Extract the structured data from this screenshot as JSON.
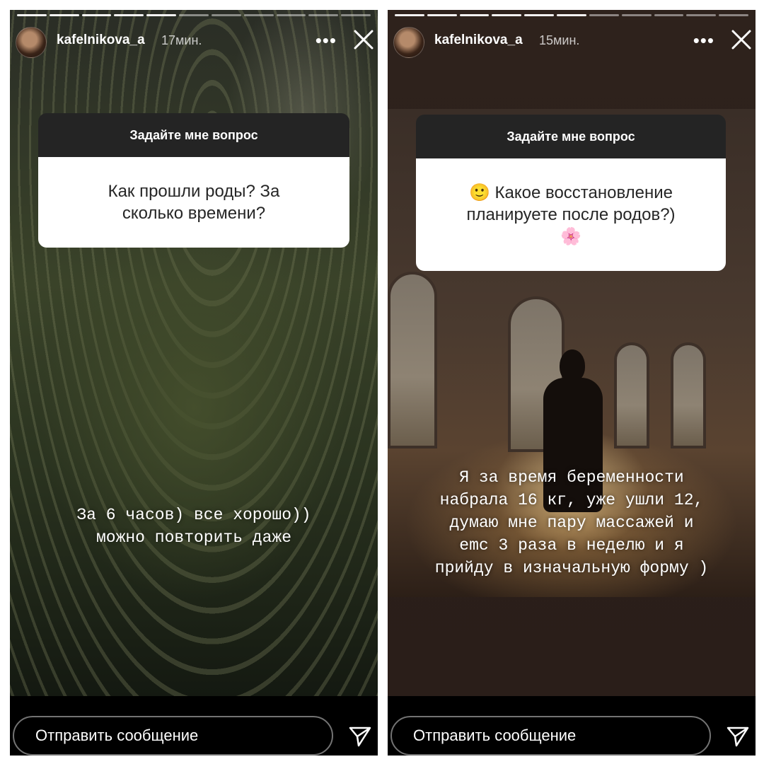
{
  "stories": [
    {
      "username": "kafelnikova_a",
      "time": "17мин.",
      "more_icon": "more-horizontal-icon",
      "close_icon": "close-icon",
      "progress": {
        "total": 11,
        "completed": 5
      },
      "question_sticker": {
        "header": "Задайте мне вопрос",
        "question": "Как прошли роды? За сколько времени?"
      },
      "overlay_text": "За 6 часов) все хорошо))\nможно повторить даже",
      "reply_placeholder": "Отправить сообщение",
      "send_icon": "paper-plane-icon"
    },
    {
      "username": "kafelnikova_a",
      "time": "15мин.",
      "more_icon": "more-horizontal-icon",
      "close_icon": "close-icon",
      "progress": {
        "total": 11,
        "completed": 6
      },
      "question_sticker": {
        "header": "Задайте мне вопрос",
        "question": "🙂 Какое восстановление планируете после родов?)🌸"
      },
      "overlay_text": "Я за время беременности\nнабрала 16 кг, уже ушли 12,\nдумаю мне пару массажей и\nemc 3 раза в неделю и я\nприйду в изначальную форму )",
      "reply_placeholder": "Отправить сообщение",
      "send_icon": "paper-plane-icon"
    }
  ]
}
